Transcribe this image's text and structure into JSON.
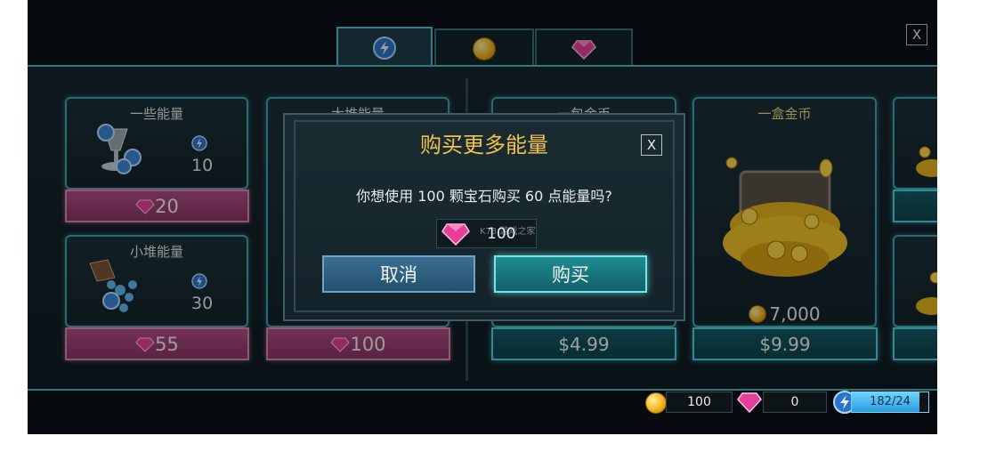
{
  "shop": {
    "tabs": [
      {
        "name": "energy",
        "icon": "lightning-icon",
        "active": true
      },
      {
        "name": "coins",
        "icon": "coin-icon",
        "active": false
      },
      {
        "name": "gems",
        "icon": "gem-icon",
        "active": false
      }
    ],
    "close_label": "X",
    "energy_items": [
      {
        "title": "一些能量",
        "amount": "10",
        "price": "20"
      },
      {
        "title": "小堆能量",
        "amount": "30",
        "price": "55"
      },
      {
        "title": "大堆能量",
        "price": "100"
      }
    ],
    "coin_items": [
      {
        "title": "一包金币",
        "price": "$4.99"
      },
      {
        "title": "一盒金币",
        "amount": "7,000",
        "price": "$9.99"
      }
    ]
  },
  "dialog": {
    "title": "购买更多能量",
    "close_label": "X",
    "message": "你想使用 100 颗宝石购买 60 点能量吗?",
    "cost": "100",
    "cancel_label": "取消",
    "buy_label": "购买"
  },
  "resources": {
    "coins": "100",
    "gems": "0",
    "energy": "182/24",
    "energy_fill": 0.88
  },
  "watermark": "K73 游戏之家",
  "colors": {
    "accent_teal": "#4fd3df",
    "gem_pink": "#b04c83",
    "title_gold": "#f0c34a"
  }
}
